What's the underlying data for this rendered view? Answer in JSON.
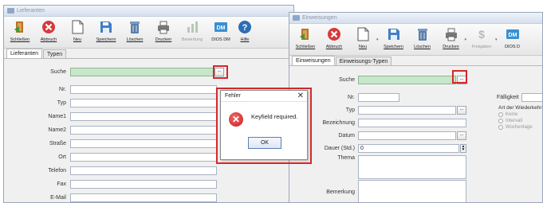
{
  "win1": {
    "title": "Lieferanten",
    "toolbar": [
      {
        "label": "Schließen",
        "icon": "close-door-icon"
      },
      {
        "label": "Abbruch",
        "icon": "cancel-icon"
      },
      {
        "label": "Neu",
        "icon": "new-document-icon"
      },
      {
        "label": "Speichern",
        "icon": "save-icon"
      },
      {
        "label": "Löschen",
        "icon": "delete-icon"
      },
      {
        "label": "Drucken",
        "icon": "print-icon"
      },
      {
        "label": "Bewertung",
        "icon": "chart-icon"
      },
      {
        "label": "DIOS DM",
        "icon": "dios-dm-icon"
      },
      {
        "label": "Hilfe",
        "icon": "help-icon"
      }
    ],
    "tabs": [
      "Lieferanten",
      "Typen"
    ],
    "search": {
      "label": "Suche",
      "value": "",
      "btn": "..."
    },
    "fields": [
      {
        "label": "Nr."
      },
      {
        "label": "Typ"
      },
      {
        "label": "Name1"
      },
      {
        "label": "Name2"
      },
      {
        "label": "Straße"
      },
      {
        "label": "Ort"
      },
      {
        "label": "Telefon"
      },
      {
        "label": "Fax"
      },
      {
        "label": "E-Mail"
      }
    ]
  },
  "win2": {
    "title": "Einweisungen",
    "toolbar": [
      {
        "label": "Schließen",
        "icon": "close-door-icon"
      },
      {
        "label": "Abbruch",
        "icon": "cancel-icon"
      },
      {
        "label": "Neu",
        "icon": "new-document-icon"
      },
      {
        "label": "Speichern",
        "icon": "save-icon"
      },
      {
        "label": "Löschen",
        "icon": "delete-icon"
      },
      {
        "label": "Drucken",
        "icon": "print-icon"
      },
      {
        "label": "Freigaben",
        "icon": "money-icon"
      },
      {
        "label": "DIOS D",
        "icon": "dios-dm-icon"
      }
    ],
    "tabs": [
      "Einweisungen",
      "Einweisungs-Typen"
    ],
    "search": {
      "label": "Suche",
      "value": "",
      "btn": "..."
    },
    "fields": [
      {
        "label": "Nr."
      },
      {
        "label": "Typ"
      },
      {
        "label": "Bezeichnung"
      },
      {
        "label": "Datum"
      },
      {
        "label": "Dauer (Std.)",
        "value": "0"
      },
      {
        "label": "Thema"
      },
      {
        "label": "Bemerkung"
      }
    ],
    "faelligkeit": "Fälligkeit",
    "wiederkehr": {
      "title": "Art der Wiederkehr",
      "options": [
        "Keine",
        "Intervall",
        "Wochentage"
      ]
    }
  },
  "dialog": {
    "title": "Fehler",
    "close": "✕",
    "message": "Keyfield required.",
    "ok": "OK",
    "icon": "error-icon"
  },
  "colors": {
    "search_green": "#c8e6c9",
    "highlight_red": "#d62828",
    "error_red": "#c81e1e"
  }
}
